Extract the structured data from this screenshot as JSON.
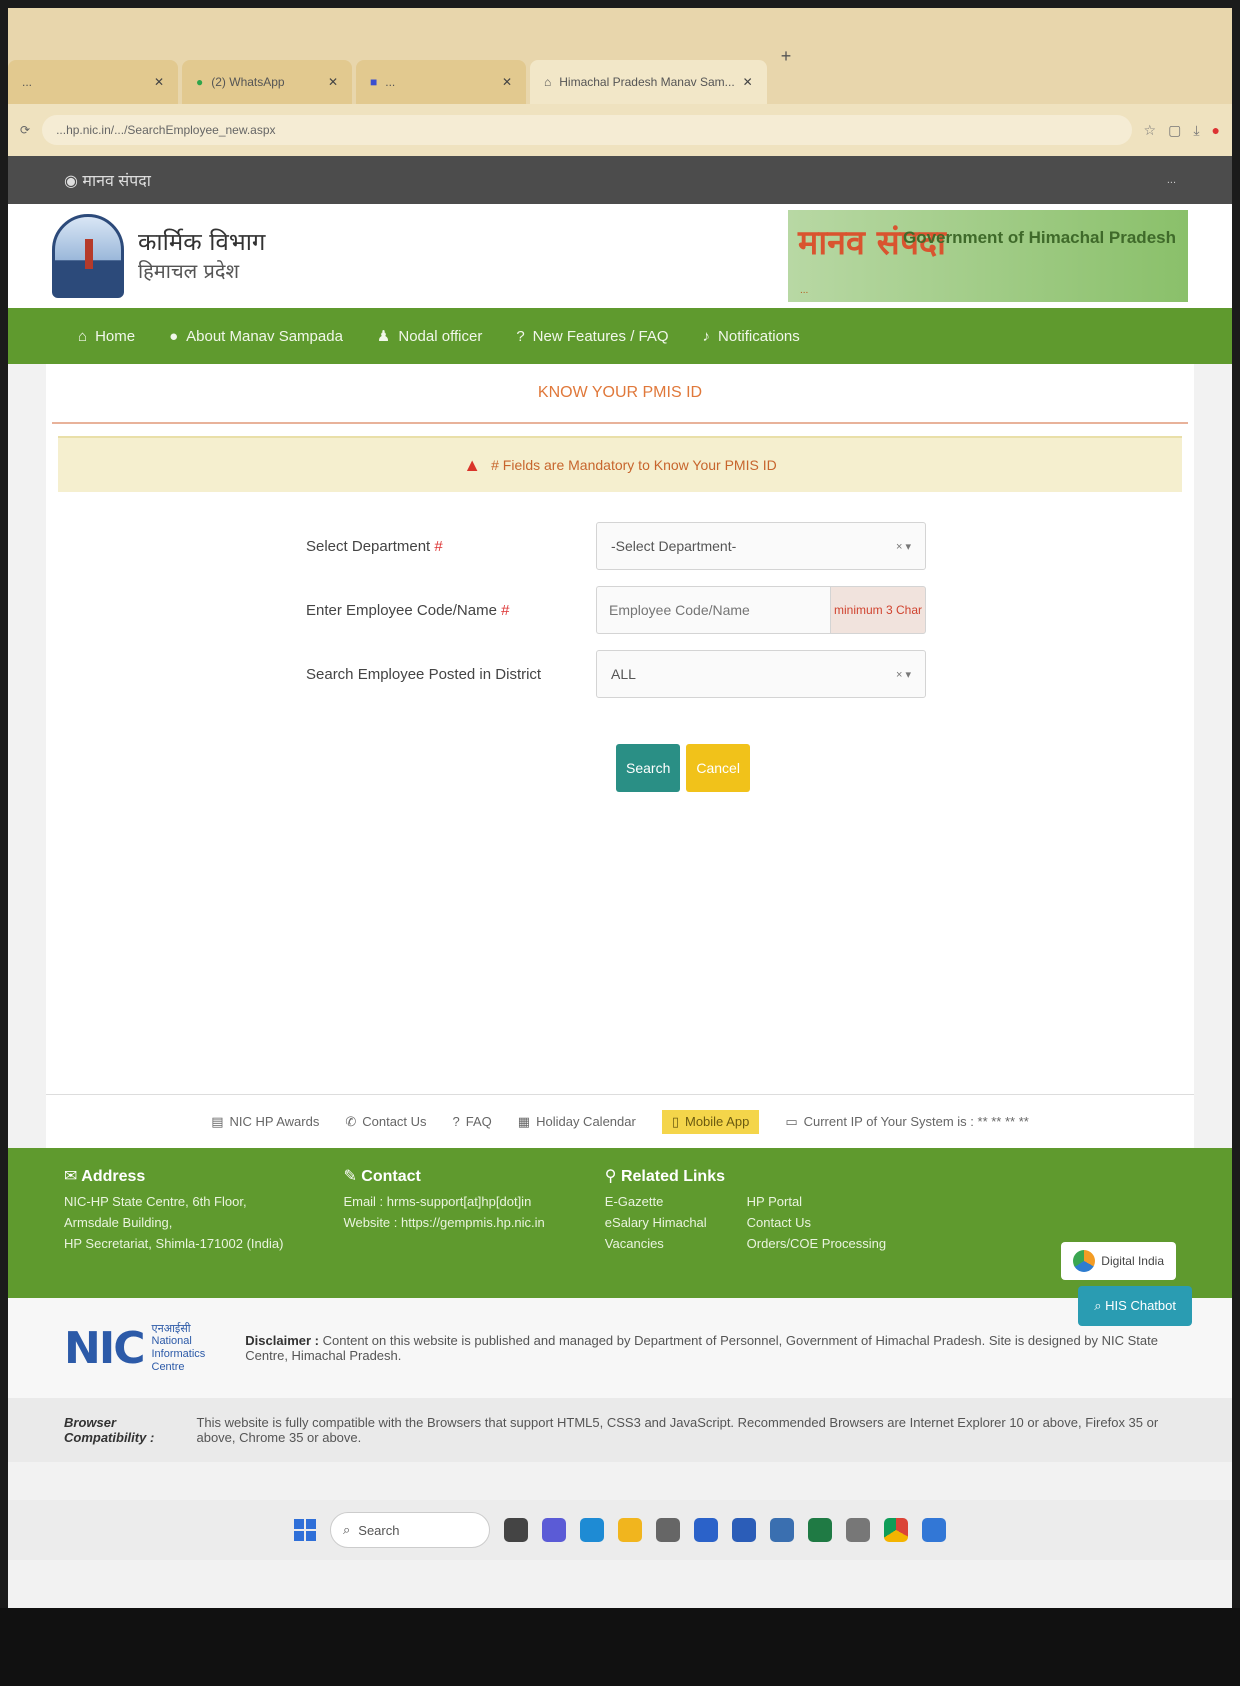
{
  "browser": {
    "tabs": [
      {
        "label": "...",
        "active": false
      },
      {
        "label": "(2) WhatsApp",
        "active": false
      },
      {
        "label": "...",
        "active": false
      },
      {
        "label": "Himachal Pradesh Manav Sam...",
        "active": true
      }
    ],
    "new_tab": "+",
    "url": "...hp.nic.in/.../SearchEmployee_new.aspx"
  },
  "site_topbar": {
    "left": "मानव संपदा",
    "right": "..."
  },
  "header": {
    "dept_title": "कार्मिक विभाग",
    "dept_sub": "हिमाचल प्रदेश",
    "banner_hindi": "मानव संपदा",
    "banner_gov": "Government of Himachal Pradesh",
    "banner_tag": "..."
  },
  "nav": {
    "items": [
      {
        "icon": "⌂",
        "label": "Home"
      },
      {
        "icon": "●",
        "label": "About Manav Sampada"
      },
      {
        "icon": "♟",
        "label": "Nodal officer"
      },
      {
        "icon": "?",
        "label": "New Features / FAQ"
      },
      {
        "icon": "♪",
        "label": "Notifications"
      }
    ]
  },
  "main": {
    "title": "KNOW YOUR PMIS ID",
    "alert": "# Fields are Mandatory to Know Your PMIS ID",
    "form": {
      "department_label": "Select Department",
      "department_value": "-Select Department-",
      "employee_label": "Enter Employee Code/Name",
      "employee_placeholder": "Employee Code/Name",
      "employee_addon": "minimum 3 Char",
      "district_label": "Search Employee Posted in District",
      "district_value": "ALL",
      "required_mark": "#",
      "clear_caret": "× ▾"
    },
    "buttons": {
      "search": "Search",
      "cancel": "Cancel"
    }
  },
  "links_strip": {
    "items": [
      {
        "label": "NIC HP Awards"
      },
      {
        "label": "Contact Us"
      },
      {
        "label": "FAQ"
      },
      {
        "label": "Holiday Calendar"
      },
      {
        "label": "Mobile App"
      },
      {
        "label": "Current IP of Your System is : ** ** ** **"
      }
    ]
  },
  "footer": {
    "address_title": "Address",
    "address_lines": [
      "NIC-HP State Centre, 6th Floor,",
      "Armsdale Building,",
      "HP Secretariat, Shimla-171002 (India)"
    ],
    "contact_title": "Contact",
    "contact_email": "Email : hrms-support[at]hp[dot]in",
    "contact_website": "Website : https://gempmis.hp.nic.in",
    "related_title": "Related Links",
    "related_col1": [
      "E-Gazette",
      "eSalary Himachal",
      "Vacancies"
    ],
    "related_col2": [
      "HP Portal",
      "Contact Us",
      "Orders/COE Processing"
    ],
    "digital_india": "Digital India"
  },
  "disclaimer": {
    "nic_hindi": "एनआईसी",
    "nic_lines": [
      "National",
      "Informatics",
      "Centre"
    ],
    "label": "Disclaimer :",
    "text": "Content on this website is published and managed by Department of Personnel, Government of Himachal Pradesh. Site is designed by NIC State Centre, Himachal Pradesh.",
    "chatbot": "HIS Chatbot"
  },
  "compat": {
    "label": "Browser Compatibility :",
    "text": "This website is fully compatible with the Browsers that support HTML5, CSS3 and JavaScript. Recommended Browsers are Internet Explorer 10 or above, Firefox 35 or above, Chrome 35 or above."
  },
  "taskbar": {
    "search": "Search"
  }
}
